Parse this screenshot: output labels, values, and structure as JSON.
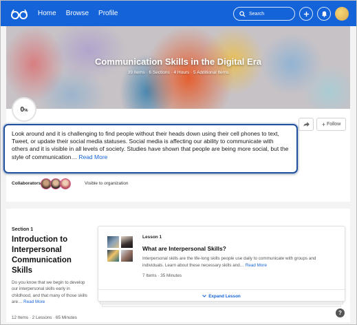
{
  "nav": {
    "links": [
      "Home",
      "Browse",
      "Profile"
    ],
    "search_placeholder": "Search",
    "add_icon": "plus-icon",
    "notifications_icon": "bell-icon"
  },
  "course": {
    "title": "Communication Skills in the Digital Era",
    "meta": "39 Items  ·  6 Sections  ·  4 Hours  ·  5 Additional Items",
    "progress": "0",
    "progress_unit": "%",
    "follow_label": "Follow",
    "description": "Look around and it is challenging to find people without their heads down using their cell phones to text, Tweet, or update their social media statuses. Social media is affecting our ability to communicate with others and it is visible in all levels of society. Studies have shown that people are being more social, but the style of communication…",
    "read_more": "Read More",
    "collaborators_label": "Collaborators:",
    "visibility": "Visible to organization"
  },
  "section": {
    "label": "Section 1",
    "title": "Introduction to Interpersonal Communication Skills",
    "description": "Do you know that we begin to develop our interpersonal skills early in childhood, and that many of those skills are…",
    "read_more": "Read More",
    "meta": "12 Items  ·  2 Lessons  ·  65 Minutes"
  },
  "lesson": {
    "label": "Lesson 1",
    "title": "What are Interpersonal Skills?",
    "description": "Interpersonal skills are the life-long skills people use daily to communicate with groups and individuals. Learn about these necessary skills and…",
    "read_more": "Read More",
    "meta": "7 Items  ·  35 Minutes",
    "expand_label": "Expand Lesson"
  },
  "help_label": "?",
  "colors": {
    "brand": "#1463d9",
    "highlight_border": "#1e4f9e"
  }
}
